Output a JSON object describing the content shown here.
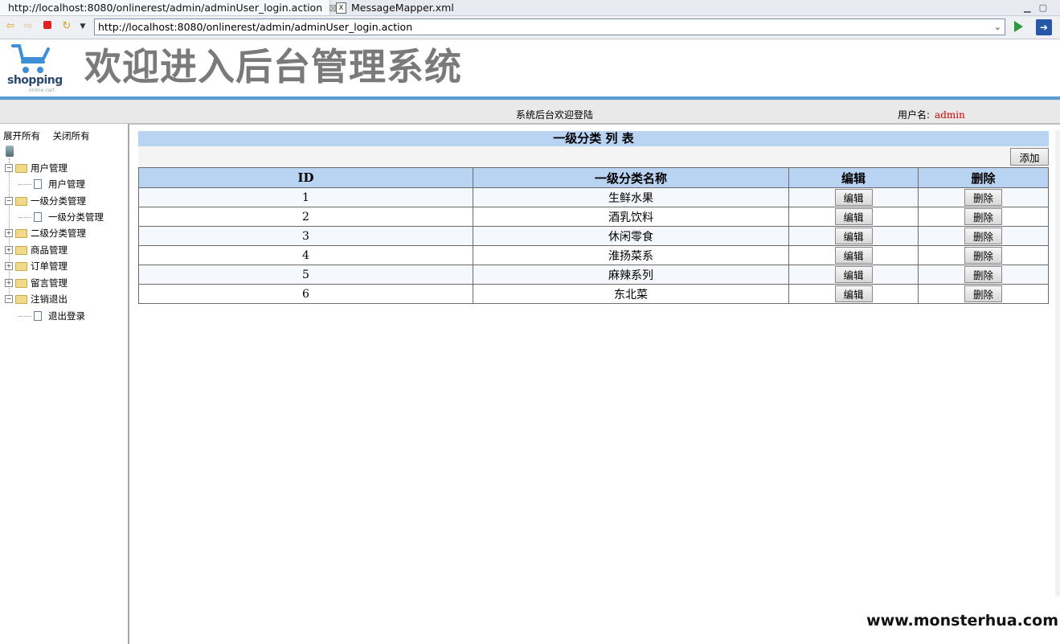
{
  "browser": {
    "tabs": [
      {
        "label": "http://localhost:8080/onlinerest/admin/adminUser_login.action",
        "active": true
      },
      {
        "label": "MessageMapper.xml",
        "active": false
      }
    ],
    "tab_close_glyph": "⊠",
    "url": "http://localhost:8080/onlinerest/admin/adminUser_login.action",
    "icons": [
      "back-icon",
      "forward-icon",
      "stop-icon",
      "refresh-icon",
      "menu-dropdown-icon",
      "go-icon",
      "external-browser-icon"
    ]
  },
  "header": {
    "logo_text": "shopping",
    "logo_sub": "online cart",
    "title": "欢迎进入后台管理系统"
  },
  "infobar": {
    "welcome": "系统后台欢迎登陆",
    "user_label": "用户名:",
    "username": "admin"
  },
  "sidebar": {
    "expand_all": "展开所有",
    "collapse_all": "关闭所有",
    "tree": [
      {
        "label": "用户管理",
        "expanded": true,
        "children": [
          "用户管理"
        ]
      },
      {
        "label": "一级分类管理",
        "expanded": true,
        "children": [
          "一级分类管理"
        ]
      },
      {
        "label": "二级分类管理",
        "expanded": false,
        "children": []
      },
      {
        "label": "商品管理",
        "expanded": false,
        "children": []
      },
      {
        "label": "订单管理",
        "expanded": false,
        "children": []
      },
      {
        "label": "留言管理",
        "expanded": false,
        "children": []
      },
      {
        "label": "注销退出",
        "expanded": true,
        "children": [
          "退出登录"
        ]
      }
    ]
  },
  "main": {
    "list_title": "一级分类 列 表",
    "add_label": "添加",
    "columns": [
      "ID",
      "一级分类名称",
      "编辑",
      "删除"
    ],
    "edit_label": "编辑",
    "delete_label": "删除",
    "rows": [
      {
        "id": "1",
        "name": "生鲜水果"
      },
      {
        "id": "2",
        "name": "酒乳饮料"
      },
      {
        "id": "3",
        "name": "休闲零食"
      },
      {
        "id": "4",
        "name": "淮扬菜系"
      },
      {
        "id": "5",
        "name": "麻辣系列"
      },
      {
        "id": "6",
        "name": "东北菜"
      }
    ]
  },
  "watermark": "www.monsterhua.com",
  "colors": {
    "accent_blue": "#b9d4f2",
    "rule_blue": "#5a9ad4",
    "username_red": "#d00000",
    "title_gray": "#7a7a7a"
  }
}
